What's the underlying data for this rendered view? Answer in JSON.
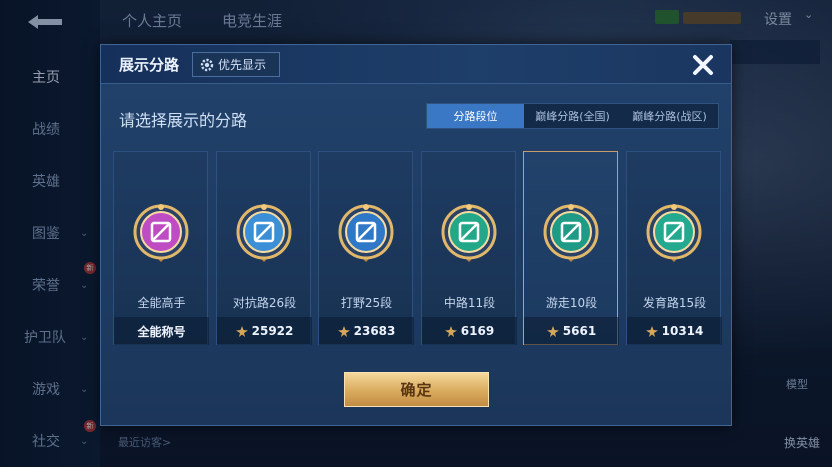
{
  "sidebar": {
    "items": [
      {
        "label": "主页",
        "active": true,
        "has_chevron": false
      },
      {
        "label": "战绩",
        "active": false,
        "has_chevron": false
      },
      {
        "label": "英雄",
        "active": false,
        "has_chevron": false
      },
      {
        "label": "图鉴",
        "active": false,
        "has_chevron": true
      },
      {
        "label": "荣誉",
        "active": false,
        "has_chevron": true,
        "badge": "新"
      },
      {
        "label": "护卫队",
        "active": false,
        "has_chevron": true
      },
      {
        "label": "游戏",
        "active": false,
        "has_chevron": true
      },
      {
        "label": "社交",
        "active": false,
        "has_chevron": true,
        "badge": "新"
      }
    ]
  },
  "topbar": {
    "tabs": [
      "个人主页",
      "电竞生涯"
    ],
    "settings_label": "设置"
  },
  "background": {
    "visitors_label": "最近访客>",
    "model_label": "模型",
    "change_hero_label": "换英雄"
  },
  "dialog": {
    "title": "展示分路",
    "priority_label": "优先显示",
    "prompt": "请选择展示的分路",
    "tabs": [
      {
        "label": "分路段位",
        "active": true
      },
      {
        "label": "巅峰分路(全国)",
        "active": false
      },
      {
        "label": "巅峰分路(战区)",
        "active": false
      }
    ],
    "cards": [
      {
        "role": "全能高手",
        "value": "全能称号",
        "has_score_icon": false,
        "emblem": "versatile-emblem-icon",
        "color": "#c04cc4",
        "selected": false
      },
      {
        "role": "对抗路26段",
        "value": "25922",
        "has_score_icon": true,
        "emblem": "clash-lane-emblem-icon",
        "color": "#3b8fd6",
        "selected": false
      },
      {
        "role": "打野25段",
        "value": "23683",
        "has_score_icon": true,
        "emblem": "jungle-emblem-icon",
        "color": "#2f78c8",
        "selected": false
      },
      {
        "role": "中路11段",
        "value": "6169",
        "has_score_icon": true,
        "emblem": "mid-lane-emblem-icon",
        "color": "#22a889",
        "selected": false
      },
      {
        "role": "游走10段",
        "value": "5661",
        "has_score_icon": true,
        "emblem": "roam-emblem-icon",
        "color": "#1f9a86",
        "selected": true
      },
      {
        "role": "发育路15段",
        "value": "10314",
        "has_score_icon": true,
        "emblem": "farm-lane-emblem-icon",
        "color": "#23a98f",
        "selected": false
      }
    ],
    "confirm_label": "确定"
  }
}
